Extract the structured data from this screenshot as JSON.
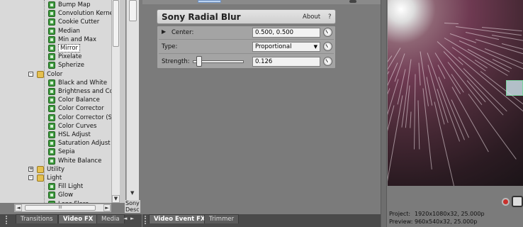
{
  "tree": {
    "items": [
      {
        "label": "Bump Map",
        "type": "fx"
      },
      {
        "label": "Convolution Kernel",
        "type": "fx"
      },
      {
        "label": "Cookie Cutter",
        "type": "fx"
      },
      {
        "label": "Median",
        "type": "fx"
      },
      {
        "label": "Min and Max",
        "type": "fx"
      },
      {
        "label": "Mirror",
        "type": "fx",
        "selected": true
      },
      {
        "label": "Pixelate",
        "type": "fx"
      },
      {
        "label": "Spherize",
        "type": "fx"
      },
      {
        "label": "Color",
        "type": "folder",
        "toggle": "-"
      },
      {
        "label": "Black and White",
        "type": "fx"
      },
      {
        "label": "Brightness and Contr",
        "type": "fx"
      },
      {
        "label": "Color Balance",
        "type": "fx"
      },
      {
        "label": "Color Corrector",
        "type": "fx"
      },
      {
        "label": "Color Corrector (Sec",
        "type": "fx"
      },
      {
        "label": "Color Curves",
        "type": "fx"
      },
      {
        "label": "HSL Adjust",
        "type": "fx"
      },
      {
        "label": "Saturation Adjust",
        "type": "fx"
      },
      {
        "label": "Sepia",
        "type": "fx"
      },
      {
        "label": "White Balance",
        "type": "fx"
      },
      {
        "label": "Utility",
        "type": "folder",
        "toggle": "+"
      },
      {
        "label": "Light",
        "type": "folder",
        "toggle": "-"
      },
      {
        "label": "Fill Light",
        "type": "fx"
      },
      {
        "label": "Glow",
        "type": "fx"
      },
      {
        "label": "Lens Flare",
        "type": "fx"
      }
    ],
    "hscroll_thumb_label": "III"
  },
  "description": {
    "line1": "Sony",
    "line2": "Desc"
  },
  "left_tabs": [
    "Transitions",
    "Video FX",
    "Media"
  ],
  "middle_tabs": [
    "Video Event FX",
    "Trimmer"
  ],
  "fx": {
    "title": "Sony Radial Blur",
    "about": "About",
    "help": "?",
    "params": [
      {
        "label": "Center:",
        "value": "0.500, 0.500"
      },
      {
        "label": "Type:",
        "value": "Proportional"
      },
      {
        "label": "Strength:",
        "value": "0.126",
        "slider_fraction": 0.03
      }
    ]
  },
  "status": {
    "project_label": "Project:",
    "project_value": "1920x1080x32, 25.000p",
    "preview_label": "Preview:",
    "preview_value": "960x540x32, 25.000p"
  }
}
